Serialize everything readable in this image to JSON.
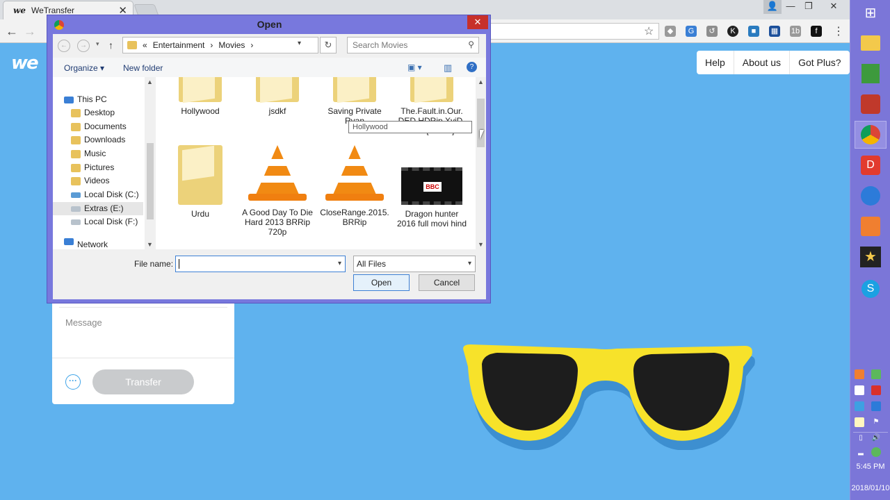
{
  "browser": {
    "tab_title": "WeTransfer",
    "tab_favicon": "we"
  },
  "page": {
    "logo": "we",
    "nav": [
      "Help",
      "About us",
      "Got Plus?"
    ],
    "message_placeholder": "Message",
    "transfer_label": "Transfer",
    "more_label": "···"
  },
  "dialog": {
    "title": "Open",
    "breadcrumb": [
      "«",
      "Entertainment",
      "›",
      "Movies",
      "›"
    ],
    "search_placeholder": "Search Movies",
    "organize_label": "Organize ▾",
    "new_folder_label": "New folder",
    "nav_items": [
      {
        "label": "This PC",
        "type": "pc"
      },
      {
        "label": "Desktop",
        "type": "folder"
      },
      {
        "label": "Documents",
        "type": "folder"
      },
      {
        "label": "Downloads",
        "type": "folder"
      },
      {
        "label": "Music",
        "type": "folder"
      },
      {
        "label": "Pictures",
        "type": "folder"
      },
      {
        "label": "Videos",
        "type": "folder"
      },
      {
        "label": "Local Disk (C:)",
        "type": "drive"
      },
      {
        "label": "Extras (E:)",
        "type": "drive",
        "selected": true
      },
      {
        "label": "Local Disk (F:)",
        "type": "drive"
      },
      {
        "label": "Network",
        "type": "network"
      }
    ],
    "files": [
      {
        "label": "Hollywood",
        "kind": "folder"
      },
      {
        "label": "jsdkf",
        "kind": "folder"
      },
      {
        "label": "Saving Private Ryan",
        "kind": "folder"
      },
      {
        "label": "The.Fault.in.Our. DED.HDRip.XviD-SaM[ETRG]",
        "kind": "folder"
      },
      {
        "label": "Urdu",
        "kind": "folder"
      },
      {
        "label": "A Good Day To Die Hard 2013 BRRip 720p",
        "kind": "vlc"
      },
      {
        "label": "CloseRange.2015. BRRip",
        "kind": "vlc"
      },
      {
        "label": "Dragon hunter 2016 full movi hind",
        "kind": "video"
      }
    ],
    "tooltip": "Hollywood",
    "file_name_label": "File name:",
    "file_name_value": "",
    "filter_value": "All Files",
    "open_label": "Open",
    "cancel_label": "Cancel"
  },
  "taskbar": {
    "time": "5:45 PM",
    "date": "2018/01/10"
  },
  "colors": {
    "page_bg": "#5fb2ee",
    "dialog_frame": "#7878dd",
    "taskbar": "#7b76d8",
    "glasses_frame": "#f7e22a"
  },
  "icons": [
    "windows-logo-icon",
    "file-explorer-icon",
    "chrome-icon",
    "skype-icon",
    "star-media-icon",
    "vlc-icon",
    "folder-icon",
    "search-icon",
    "refresh-icon"
  ]
}
